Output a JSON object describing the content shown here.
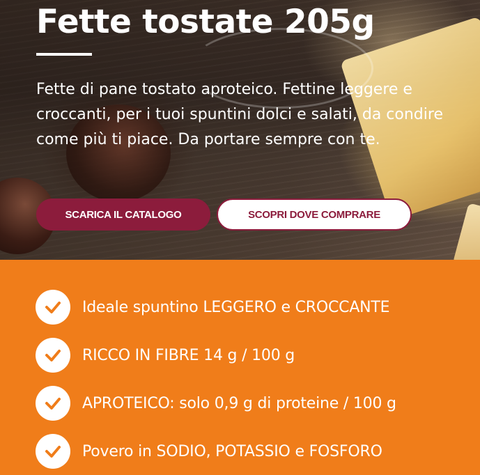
{
  "hero": {
    "title": "Fette tostate 205g",
    "description": "Fette di pane tostato aproteico. Fettine leggere e croccanti, per i tuoi spuntini dolci e salati, da condire come più ti piace. Da portare sempre con te.",
    "buttons": {
      "catalog_label": "SCARICA IL CATALOGO",
      "where_label": "SCOPRI DOVE COMPRARE"
    }
  },
  "features": {
    "items": [
      {
        "label": "Ideale spuntino LEGGERO e CROCCANTE",
        "icon": "check-icon"
      },
      {
        "label": "RICCO IN FIBRE 14 g / 100 g",
        "icon": "check-icon"
      },
      {
        "label": "APROTEICO: solo 0,9 g di proteine / 100 g",
        "icon": "check-icon"
      },
      {
        "label": "Povero in SODIO, POTASSIO e FOSFORO",
        "icon": "check-icon"
      }
    ]
  },
  "colors": {
    "brand_burgundy": "#8c1c3c",
    "accent_orange": "#f07d1a",
    "text_white": "#ffffff"
  }
}
